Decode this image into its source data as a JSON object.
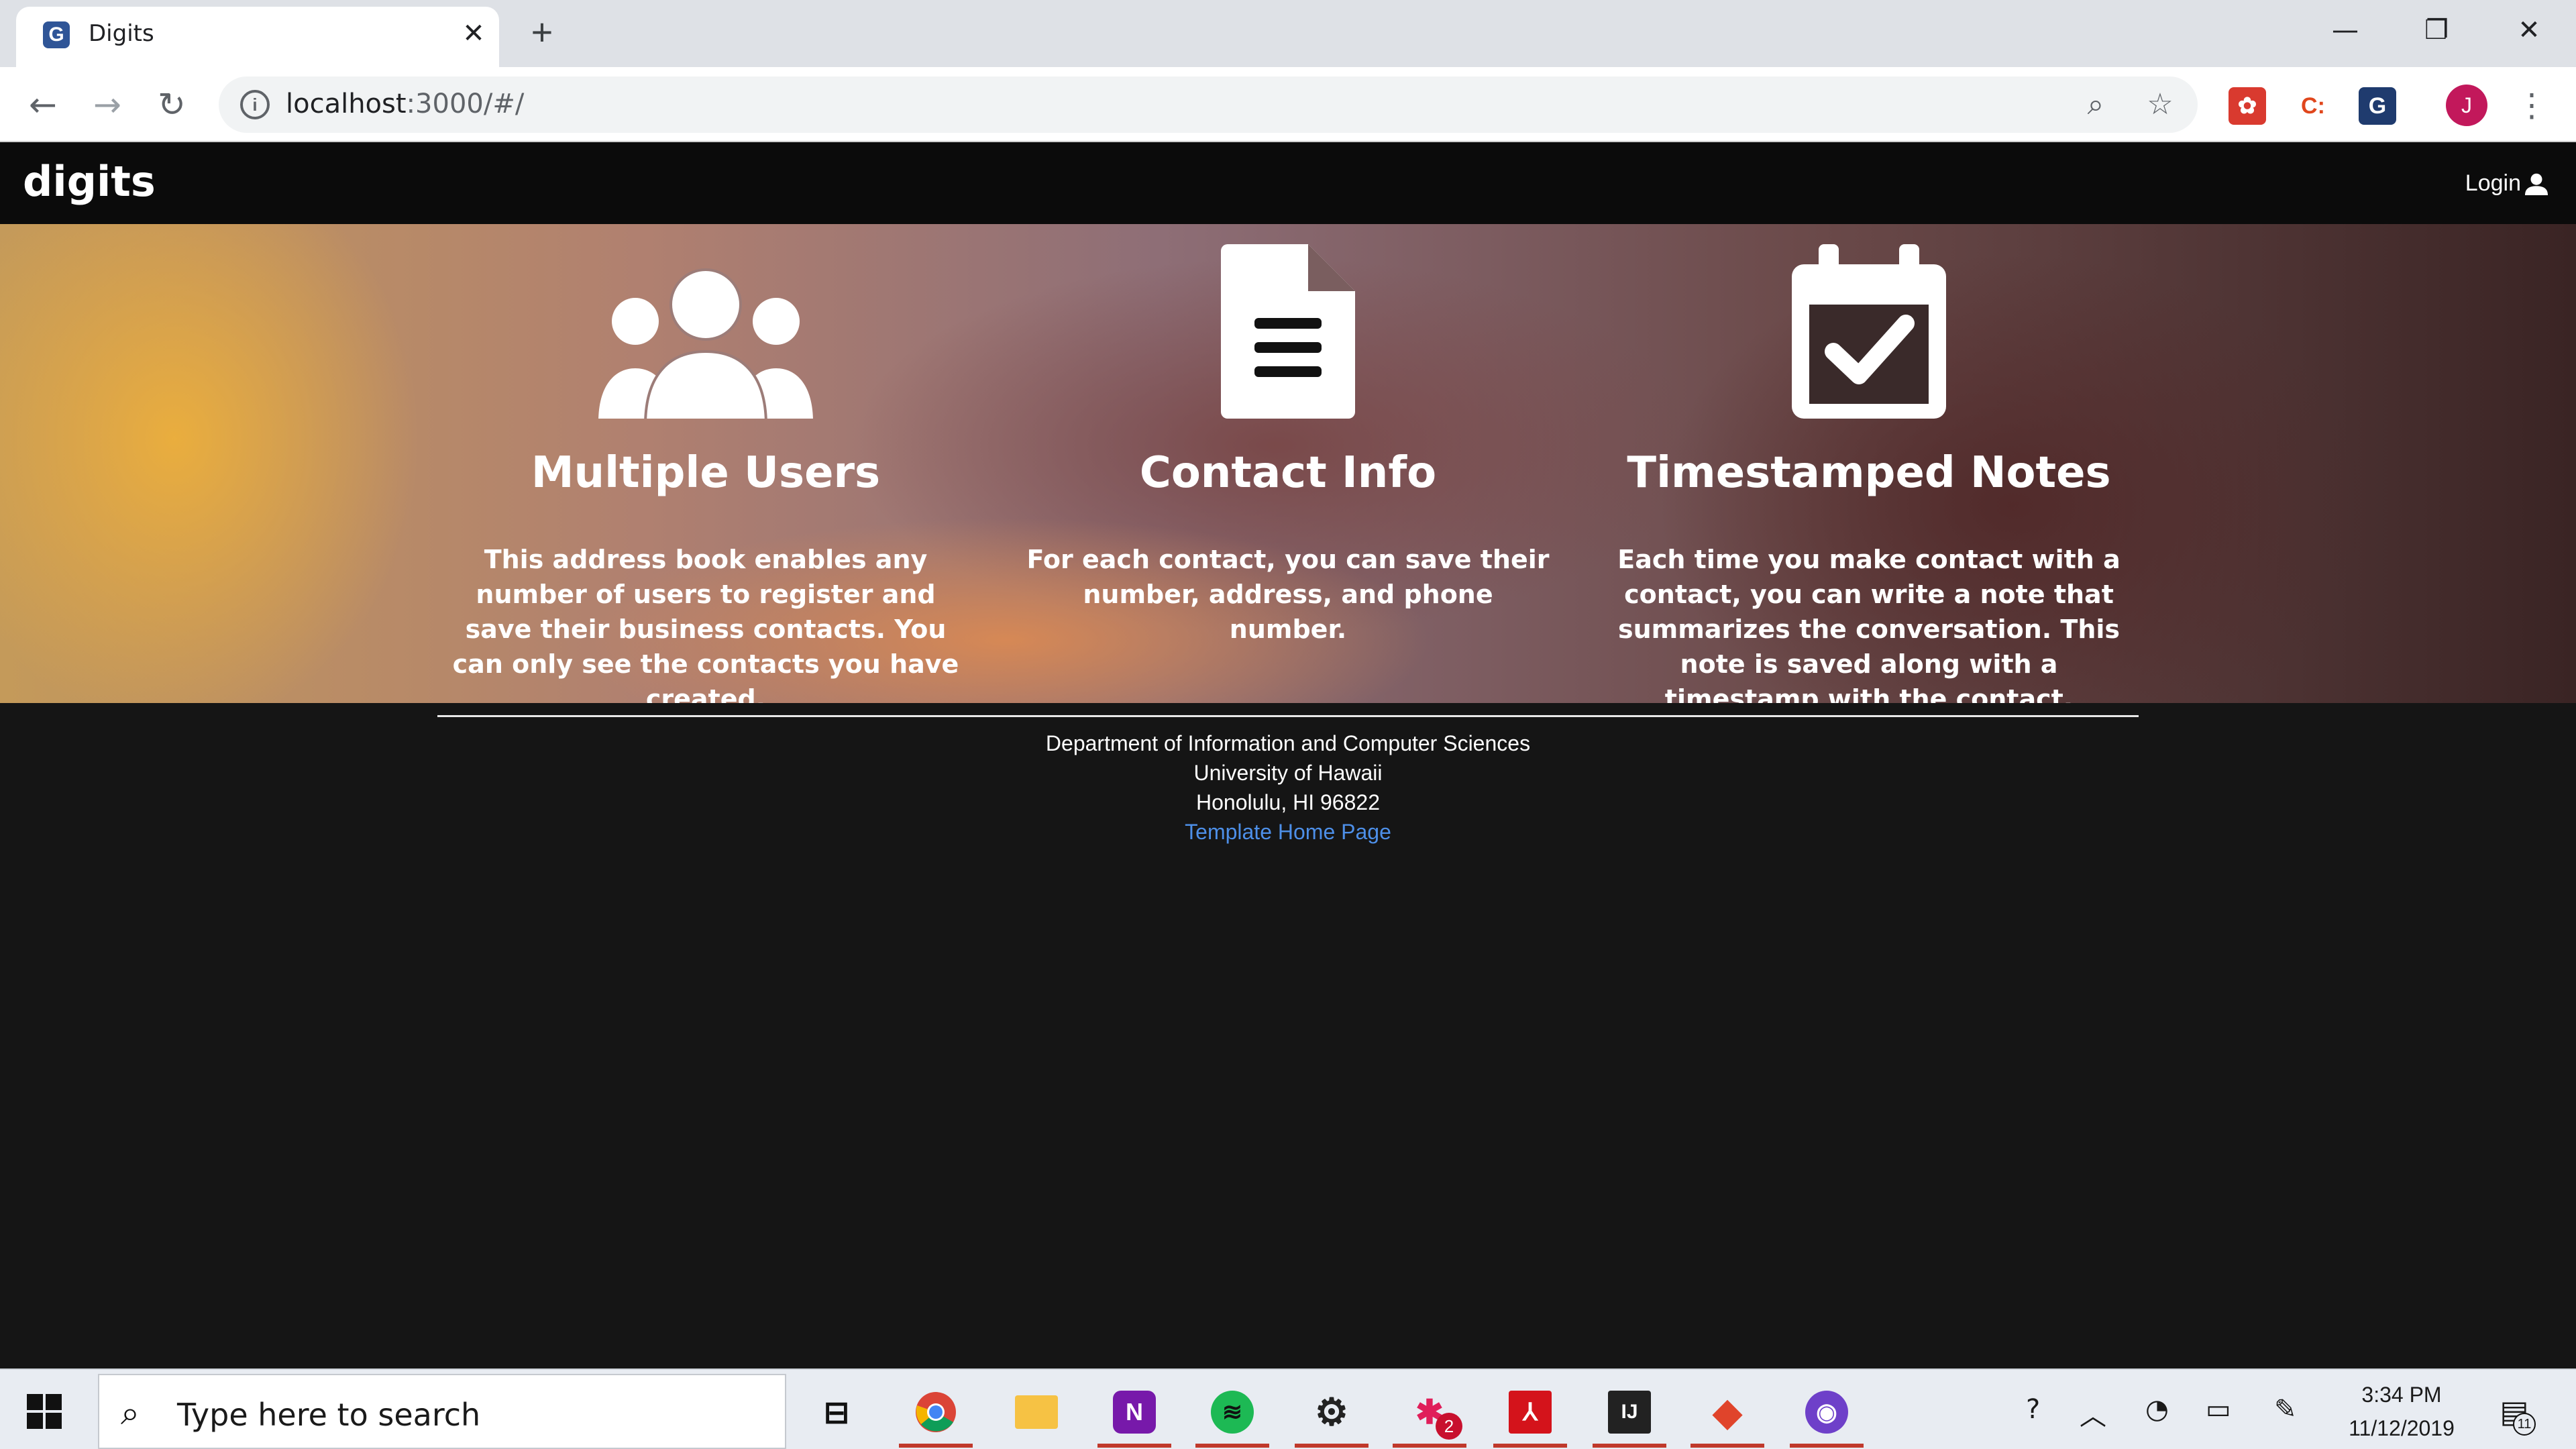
{
  "browser": {
    "tab_title": "Digits",
    "tab_favicon": "G",
    "url_host": "localhost",
    "url_rest": ":3000/#/",
    "new_tab": "+",
    "close_tab": "✕",
    "minimize": "—",
    "restore": "❐",
    "close_window": "✕",
    "profile_initial": "J"
  },
  "site": {
    "brand": "digits",
    "login_label": "Login"
  },
  "features": [
    {
      "icon": "users-icon",
      "title": "Multiple Users",
      "text": "This address book enables any number of users to register and save their business contacts. You can only see the contacts you have created."
    },
    {
      "icon": "file-text-icon",
      "title": "Contact Info",
      "text": "For each contact, you can save their number, address, and phone number."
    },
    {
      "icon": "calendar-check-icon",
      "title": "Timestamped Notes",
      "text": "Each time you make contact with a contact, you can write a note that summarizes the conversation. This note is saved along with a timestamp with the contact."
    }
  ],
  "footer": {
    "line1": "Department of Information and Computer Sciences",
    "line2": "University of Hawaii",
    "line3": "Honolulu, HI 96822",
    "link": "Template Home Page"
  },
  "taskbar": {
    "search_placeholder": "Type here to search",
    "time": "3:34 PM",
    "date": "11/12/2019",
    "slack_badge": "2",
    "notifications": "11"
  },
  "colors": {
    "navbar": "#0b0b0b",
    "page_bg": "#151515",
    "link": "#4d8fe8"
  }
}
